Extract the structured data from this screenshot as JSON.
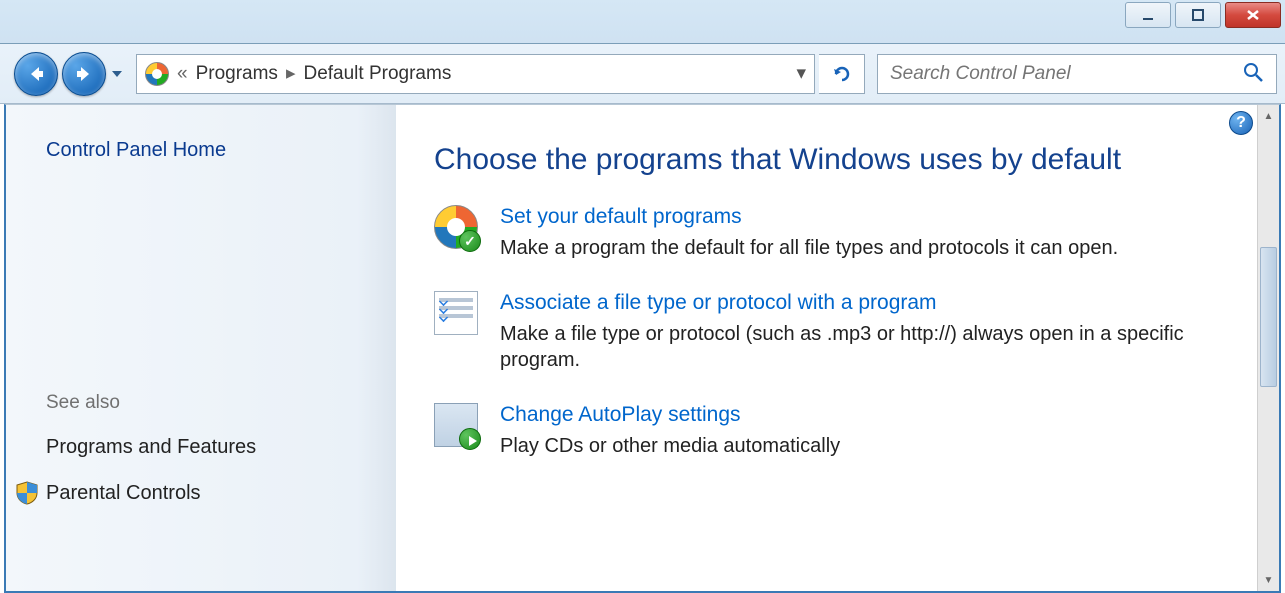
{
  "titlebar": {},
  "nav": {
    "breadcrumb": {
      "level1": "Programs",
      "level2": "Default Programs"
    },
    "search_placeholder": "Search Control Panel"
  },
  "sidebar": {
    "home": "Control Panel Home",
    "see_also_label": "See also",
    "links": {
      "programs_features": "Programs and Features",
      "parental_controls": "Parental Controls"
    }
  },
  "main": {
    "heading": "Choose the programs that Windows uses by default",
    "tasks": [
      {
        "link": "Set your default programs",
        "desc": "Make a program the default for all file types and protocols it can open."
      },
      {
        "link": "Associate a file type or protocol with a program",
        "desc": "Make a file type or protocol (such as .mp3 or http://) always open in a specific program."
      },
      {
        "link": "Change AutoPlay settings",
        "desc": "Play CDs or other media automatically"
      }
    ]
  }
}
